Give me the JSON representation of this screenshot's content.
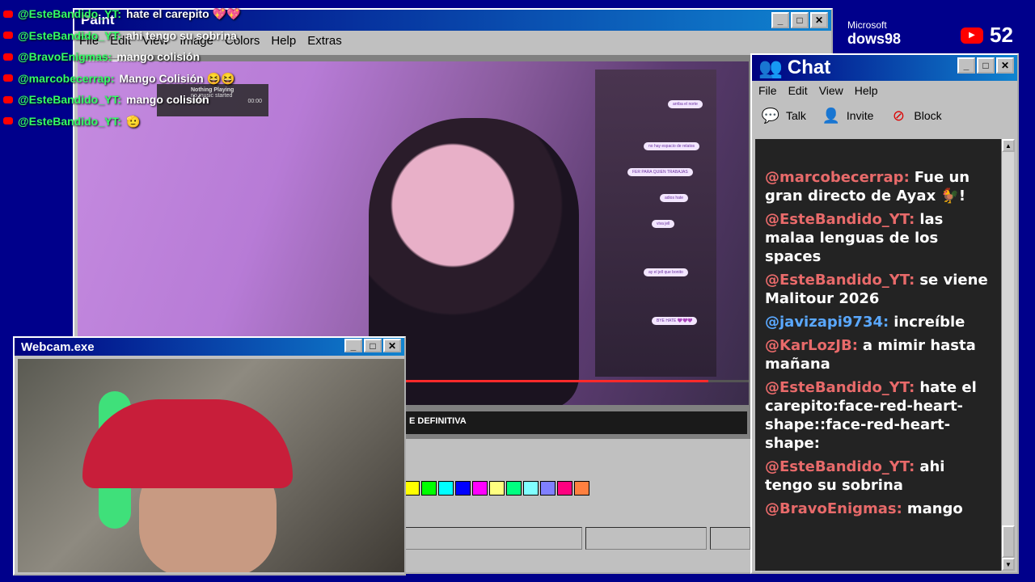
{
  "paint": {
    "title": "Paint",
    "menu": [
      "File",
      "Edit",
      "View",
      "Image",
      "Colors",
      "Help",
      "Extras"
    ],
    "video_caption": "E DEFINITIVA",
    "now_playing": {
      "title": "Nothing Playing",
      "subtitle": "no music started",
      "time_start": "00:00",
      "time_end": "00:00"
    },
    "palette": [
      "#ffff00",
      "#00ff00",
      "#00ffff",
      "#0000ff",
      "#ff00ff",
      "#ffff80",
      "#00ff80",
      "#80ffff",
      "#8080ff",
      "#ff0080",
      "#ff8040"
    ],
    "video_progress": 0.94
  },
  "overlay_chat": [
    {
      "user": "@EsteBandido_YT:",
      "text": "hate el carepito 💖💖"
    },
    {
      "user": "@EsteBandido_YT:",
      "text": "ahi tengo su sobrina"
    },
    {
      "user": "@BravoEnigmas:",
      "text": "mango colisión"
    },
    {
      "user": "@marcobecerrap:",
      "text": "Mango Colisión 😆😆"
    },
    {
      "user": "@EsteBandido_YT:",
      "text": "mango colisión"
    },
    {
      "user": "@EsteBandido_YT:",
      "text": "🫡"
    }
  ],
  "chat": {
    "title": "Chat",
    "menu": [
      "File",
      "Edit",
      "View",
      "Help"
    ],
    "tools": {
      "talk": "Talk",
      "invite": "Invite",
      "block": "Block"
    },
    "messages": [
      {
        "user": "@marcobecerrap:",
        "text": "Fue un gran directo de Ayax 🐓!",
        "color": "#e86a6a"
      },
      {
        "user": "@EsteBandido_YT:",
        "text": "las malaa lenguas de los spaces",
        "color": "#e86a6a"
      },
      {
        "user": "@EsteBandido_YT:",
        "text": "se viene Malitour 2026",
        "color": "#e86a6a"
      },
      {
        "user": "@javizapi9734:",
        "text": "increíble",
        "color": "#5aa8ff"
      },
      {
        "user": "@KarLozJB:",
        "text": "a mimir hasta mañana",
        "color": "#e86a6a"
      },
      {
        "user": "@EsteBandido_YT:",
        "text": "hate el carepito:face-red-heart-shape::face-red-heart-shape:",
        "color": "#e86a6a"
      },
      {
        "user": "@EsteBandido_YT:",
        "text": "ahi tengo su sobrina",
        "color": "#e86a6a"
      },
      {
        "user": "@BravoEnigmas:",
        "text": "mango",
        "color": "#e86a6a"
      }
    ]
  },
  "webcam": {
    "title": "Webcam.exe"
  },
  "branding": {
    "ms_small": "Microsoft",
    "ms_big": "dows98",
    "viewer_count": "52"
  }
}
